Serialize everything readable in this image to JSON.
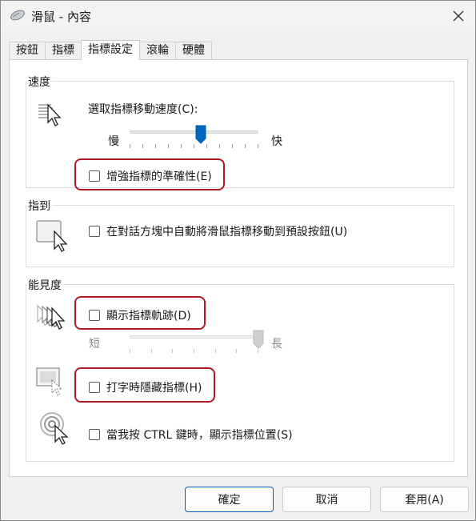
{
  "window": {
    "title": "滑鼠 - 內容"
  },
  "tabs": [
    {
      "label": "按鈕"
    },
    {
      "label": "指標"
    },
    {
      "label": "指標設定"
    },
    {
      "label": "滾輪"
    },
    {
      "label": "硬體"
    }
  ],
  "active_tab_index": 2,
  "speed": {
    "group_label": "速度",
    "prompt": "選取指標移動速度(C):",
    "slow_label": "慢",
    "fast_label": "快",
    "slider_level": 0.55,
    "enhance_precision": {
      "label": "增強指標的準確性(E)",
      "checked": false
    }
  },
  "snap_to": {
    "group_label": "指到",
    "option": {
      "label": "在對話方塊中自動將滑鼠指標移動到預設按鈕(U)",
      "checked": false
    }
  },
  "visibility": {
    "group_label": "能見度",
    "show_trails": {
      "label": "顯示指標軌跡(D)",
      "checked": false
    },
    "trail_short_label": "短",
    "trail_long_label": "長",
    "trail_slider_level": 1.0,
    "hide_while_typing": {
      "label": "打字時隱藏指標(H)",
      "checked": false
    },
    "show_location": {
      "label": "當我按 CTRL 鍵時，顯示指標位置(S)",
      "checked": false
    }
  },
  "buttons": {
    "ok": "確定",
    "cancel": "取消",
    "apply": "套用(A)"
  },
  "colors": {
    "accent": "#0067c0",
    "highlight_ring": "#b01b22"
  }
}
